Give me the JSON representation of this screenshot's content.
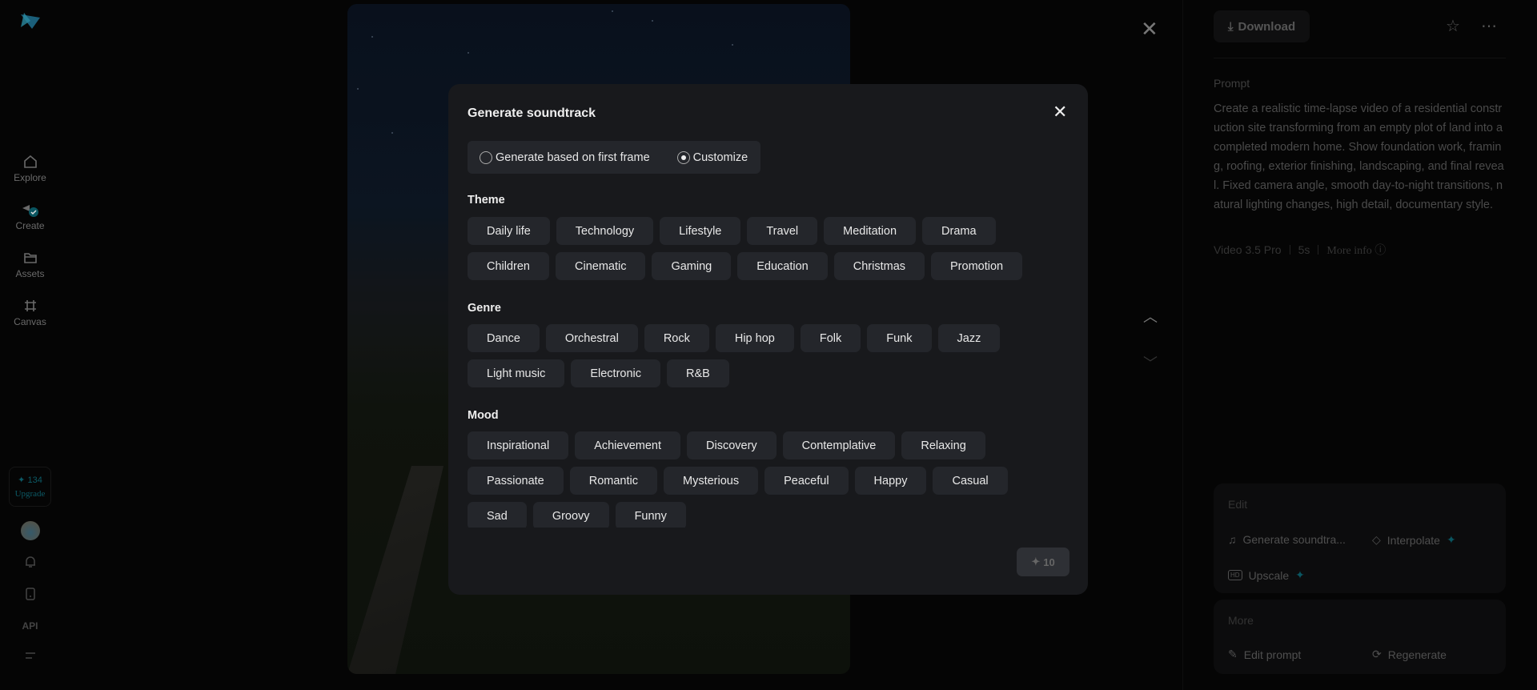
{
  "sidebar": {
    "items": [
      {
        "label": "Explore"
      },
      {
        "label": "Create"
      },
      {
        "label": "Assets"
      },
      {
        "label": "Canvas"
      }
    ],
    "credits": "134",
    "upgrade": "Upgrade",
    "api": "API"
  },
  "right": {
    "download": "Download",
    "prompt_label": "Prompt",
    "prompt": "Create a realistic time-lapse video of a residential construction site transforming from an empty plot of land into a completed modern home. Show foundation work, framing, roofing, exterior finishing, landscaping, and final reveal. Fixed camera angle, smooth day-to-night transitions, natural lighting changes, high detail, documentary style.",
    "model": "Video 3.5 Pro",
    "duration": "5s",
    "more_info": "More info",
    "edit": {
      "title": "Edit",
      "soundtrack": "Generate soundtra...",
      "interpolate": "Interpolate",
      "upscale": "Upscale"
    },
    "more": {
      "title": "More",
      "edit_prompt": "Edit prompt",
      "regenerate": "Regenerate"
    }
  },
  "modal": {
    "title": "Generate soundtrack",
    "options": [
      {
        "label": "Generate based on first frame",
        "selected": false
      },
      {
        "label": "Customize",
        "selected": true
      }
    ],
    "theme_label": "Theme",
    "themes": [
      "Daily life",
      "Technology",
      "Lifestyle",
      "Travel",
      "Meditation",
      "Drama",
      "Children",
      "Cinematic",
      "Gaming",
      "Education",
      "Christmas",
      "Promotion"
    ],
    "genre_label": "Genre",
    "genres": [
      "Dance",
      "Orchestral",
      "Rock",
      "Hip hop",
      "Folk",
      "Funk",
      "Jazz",
      "Light music",
      "Electronic",
      "R&B"
    ],
    "mood_label": "Mood",
    "moods": [
      "Inspirational",
      "Achievement",
      "Discovery",
      "Contemplative",
      "Relaxing",
      "Passionate",
      "Romantic",
      "Mysterious",
      "Peaceful",
      "Happy",
      "Casual",
      "Sad",
      "Groovy",
      "Funny"
    ],
    "cost": "10"
  },
  "colors": {
    "accent": "#0a5560",
    "modal_bg": "#18191c",
    "chip_bg": "#24262b"
  }
}
